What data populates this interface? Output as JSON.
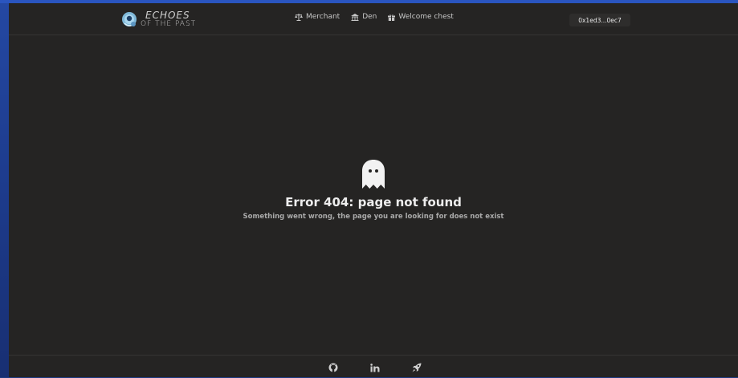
{
  "brand": {
    "line1": "ECHOES",
    "line2": "OF THE PAST"
  },
  "nav": {
    "items": [
      {
        "label": "Merchant",
        "icon": "scale-icon"
      },
      {
        "label": "Den",
        "icon": "den-icon"
      },
      {
        "label": "Welcome chest",
        "icon": "gift-icon"
      }
    ]
  },
  "wallet": {
    "address": "0x1ed3...0ec7"
  },
  "error": {
    "icon": "ghost-icon",
    "title": "Error 404: page not found",
    "message": "Something went wrong, the page you are looking for does not exist"
  },
  "footer": {
    "icons": [
      "github-icon",
      "linkedin-icon",
      "rocket-icon"
    ]
  },
  "colors": {
    "background": "#252423",
    "desktop": "#1f3b82",
    "text": "#ededed"
  }
}
